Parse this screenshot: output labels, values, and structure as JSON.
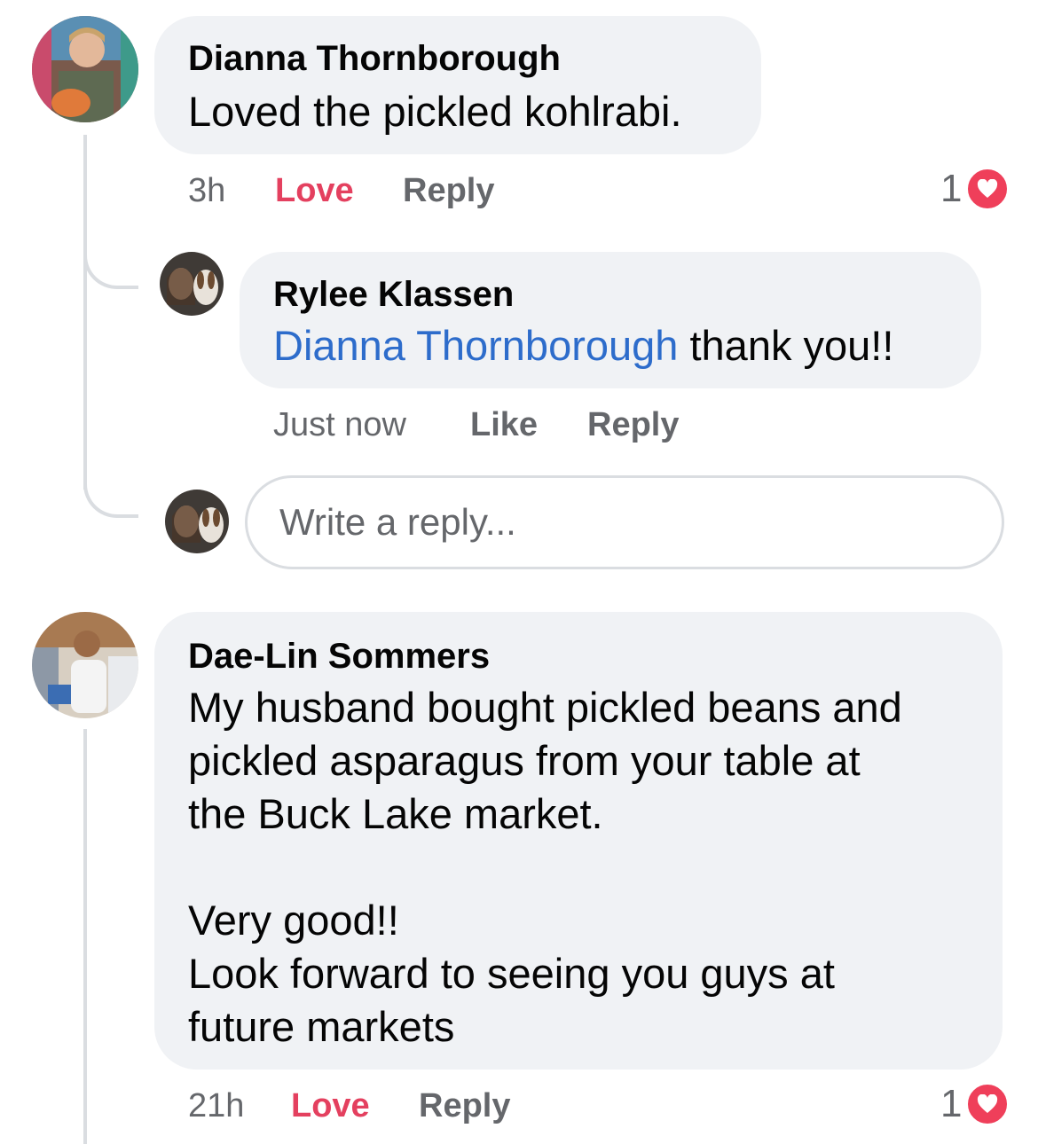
{
  "colors": {
    "bubble": "#f0f2f5",
    "love": "#e4405f",
    "mention": "#2d6ccb",
    "meta": "#65676b",
    "heart": "#ef3f5a"
  },
  "comments": [
    {
      "author": "Dianna Thornborough",
      "text": "Loved the pickled kohlrabi.",
      "time": "3h",
      "reaction_label": "Love",
      "reply_label": "Reply",
      "reaction_count": "1",
      "reaction_icon": "heart-icon"
    },
    {
      "author": "Dae-Lin Sommers",
      "text_lines": [
        "My husband bought pickled beans and",
        "pickled asparagus from your table at",
        "the Buck Lake market.",
        "",
        "Very good!!",
        "Look forward to seeing you guys at",
        "future markets"
      ],
      "time": "21h",
      "reaction_label": "Love",
      "reply_label": "Reply",
      "reaction_count": "1",
      "reaction_icon": "heart-icon"
    }
  ],
  "reply": {
    "author": "Rylee Klassen",
    "mention": "Dianna Thornborough",
    "text": " thank you!!",
    "time": "Just now",
    "like_label": "Like",
    "reply_label": "Reply"
  },
  "reply_input": {
    "placeholder": "Write a reply..."
  }
}
